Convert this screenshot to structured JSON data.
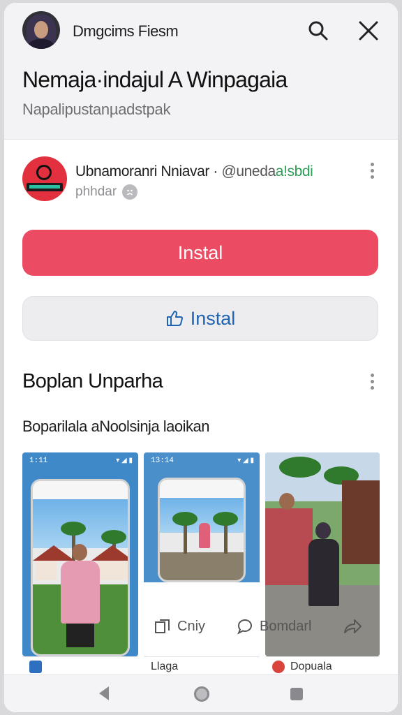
{
  "header": {
    "account_name": "Dmgcims Fiesm",
    "title": "Nemaja·indajul A Winpagaia",
    "subtitle": "Napalipustanµadstpak"
  },
  "app": {
    "name": "Ubnamoranri Nniavar",
    "separator": "·",
    "handle": "@unedа",
    "handle_accent": "a!sbdi",
    "meta": "phhdar"
  },
  "buttons": {
    "install_primary": "Instal",
    "install_secondary": "Instal"
  },
  "section": {
    "title": "Boplan Unparha",
    "description": "Boparilala aNoolsinja laoikan"
  },
  "screenshots": {
    "s1_time": "1:11",
    "s2_time": "13:14",
    "copy_label": "Cniy",
    "comment_label": "Bomdarl",
    "card2_label": "Llaga",
    "card3_label": "Dopuala"
  },
  "colors": {
    "primary": "#ec4c63",
    "secondary_text": "#1f63b5",
    "handle_accent": "#2e9d57"
  },
  "icons": [
    "search-icon",
    "close-icon",
    "more-vertical-icon",
    "thumbs-up-icon",
    "copy-icon",
    "comment-icon",
    "share-icon",
    "back-icon",
    "home-icon",
    "recents-icon"
  ]
}
